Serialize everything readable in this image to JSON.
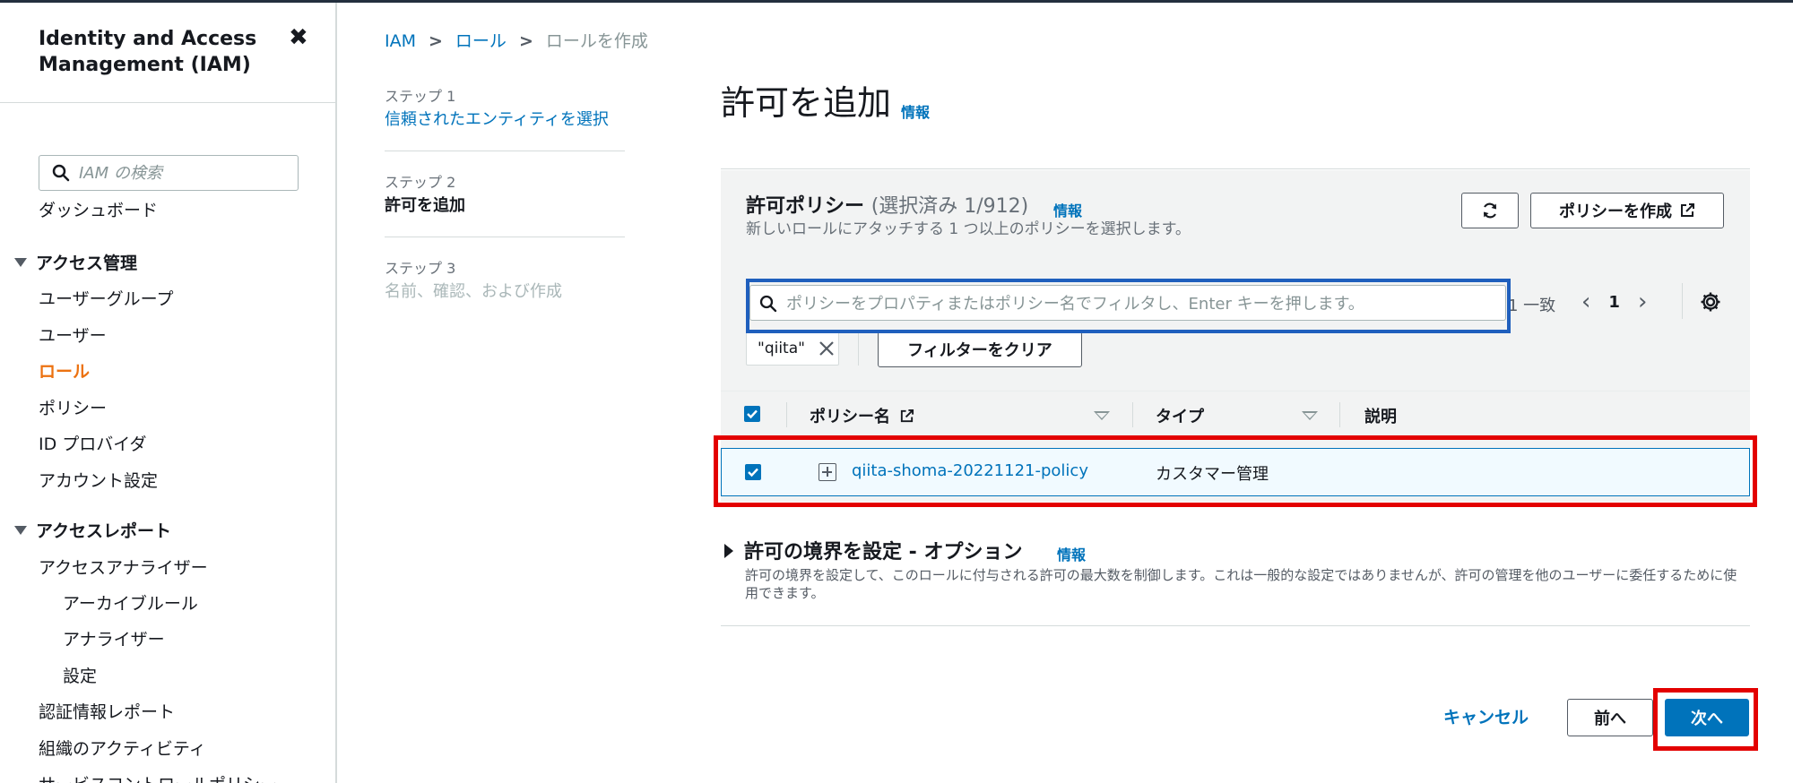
{
  "sidebar": {
    "title": "Identity and Access Management (IAM)",
    "search_placeholder": "IAM の検索",
    "dashboard": "ダッシュボード",
    "access_management": "アクセス管理",
    "items_access": [
      "ユーザーグループ",
      "ユーザー",
      "ロール",
      "ポリシー",
      "ID プロバイダ",
      "アカウント設定"
    ],
    "active_item": "ロール",
    "access_reports": "アクセスレポート",
    "access_analyzer": "アクセスアナライザー",
    "analyzer_sub": [
      "アーカイブルール",
      "アナライザー",
      "設定"
    ],
    "items_reports": [
      "認証情報レポート",
      "組織のアクティビティ",
      "サービスコントロールポリシー"
    ]
  },
  "breadcrumb": {
    "iam": "IAM",
    "roles": "ロール",
    "current": "ロールを作成"
  },
  "steps": [
    {
      "num": "ステップ 1",
      "label": "信頼されたエンティティを選択"
    },
    {
      "num": "ステップ 2",
      "label": "許可を追加"
    },
    {
      "num": "ステップ 3",
      "label": "名前、確認、および作成"
    }
  ],
  "page": {
    "title": "許可を追加",
    "info": "情報"
  },
  "policies": {
    "title": "許可ポリシー",
    "count": "(選択済み 1/912)",
    "info": "情報",
    "description": "新しいロールにアタッチする 1 つ以上のポリシーを選択します。",
    "create_button": "ポリシーを作成",
    "search_placeholder": "ポリシーをプロパティまたはポリシー名でフィルタし、Enter キーを押します。",
    "match_text": "1 一致",
    "page_number": "1",
    "token": "\"qiita\"",
    "clear_filter": "フィルターをクリア",
    "columns": [
      "ポリシー名",
      "タイプ",
      "説明"
    ],
    "rows": [
      {
        "name": "qiita-shoma-20221121-policy",
        "type": "カスタマー管理",
        "description": ""
      }
    ]
  },
  "boundary": {
    "title": "許可の境界を設定 - オプション",
    "info": "情報",
    "description": "許可の境界を設定して、このロールに付与される許可の最大数を制御します。これは一般的な設定ではありませんが、許可の管理を他のユーザーに委任するために使用できます。"
  },
  "footer": {
    "cancel": "キャンセル",
    "previous": "前へ",
    "next": "次へ"
  },
  "colors": {
    "link": "#0073bb",
    "active": "#ec7211",
    "highlight_red": "#e30000",
    "highlight_blue": "#1f5fbd"
  }
}
